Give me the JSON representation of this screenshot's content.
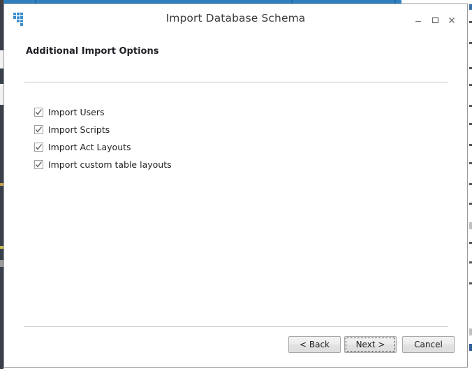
{
  "window": {
    "title": "Import Database Schema",
    "app_icon": "database-grid-icon",
    "controls": {
      "minimize": "minimize-icon",
      "maximize": "maximize-icon",
      "close": "close-icon"
    }
  },
  "page": {
    "header": "Additional Import Options"
  },
  "options": [
    {
      "label": "Import Users",
      "checked": true
    },
    {
      "label": "Import Scripts",
      "checked": true
    },
    {
      "label": "Import Act Layouts",
      "checked": true
    },
    {
      "label": "Import custom table layouts",
      "checked": true
    }
  ],
  "footer": {
    "back_label": "< Back",
    "next_label": "Next >",
    "cancel_label": "Cancel"
  },
  "colors": {
    "accent_blue": "#3a8dcc",
    "background_dark": "#39404c",
    "separator": "#c9c9c9",
    "title_text": "#3c3c3c"
  }
}
